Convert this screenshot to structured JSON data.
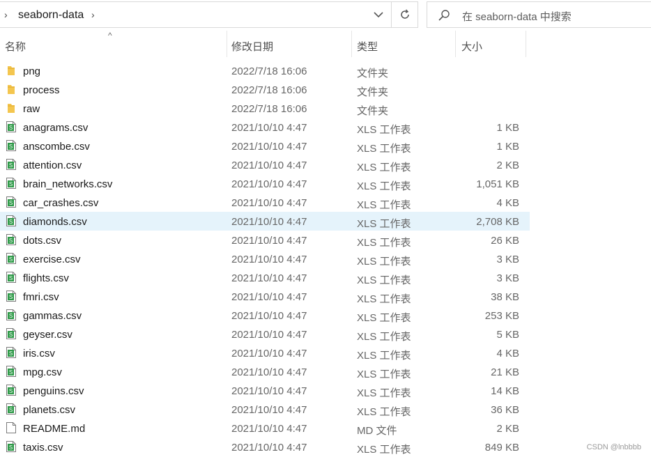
{
  "address": {
    "path": "seaborn-data"
  },
  "search": {
    "placeholder": "在 seaborn-data 中搜索"
  },
  "columns": {
    "name": "名称",
    "date": "修改日期",
    "type": "类型",
    "size": "大小"
  },
  "files": [
    {
      "name": "png",
      "date": "2022/7/18 16:06",
      "type": "文件夹",
      "size": "",
      "icon": "folder-icon"
    },
    {
      "name": "process",
      "date": "2022/7/18 16:06",
      "type": "文件夹",
      "size": "",
      "icon": "folder-icon"
    },
    {
      "name": "raw",
      "date": "2022/7/18 16:06",
      "type": "文件夹",
      "size": "",
      "icon": "folder-icon"
    },
    {
      "name": "anagrams.csv",
      "date": "2021/10/10 4:47",
      "type": "XLS 工作表",
      "size": "1 KB",
      "icon": "spreadsheet-icon"
    },
    {
      "name": "anscombe.csv",
      "date": "2021/10/10 4:47",
      "type": "XLS 工作表",
      "size": "1 KB",
      "icon": "spreadsheet-icon"
    },
    {
      "name": "attention.csv",
      "date": "2021/10/10 4:47",
      "type": "XLS 工作表",
      "size": "2 KB",
      "icon": "spreadsheet-icon"
    },
    {
      "name": "brain_networks.csv",
      "date": "2021/10/10 4:47",
      "type": "XLS 工作表",
      "size": "1,051 KB",
      "icon": "spreadsheet-icon"
    },
    {
      "name": "car_crashes.csv",
      "date": "2021/10/10 4:47",
      "type": "XLS 工作表",
      "size": "4 KB",
      "icon": "spreadsheet-icon"
    },
    {
      "name": "diamonds.csv",
      "date": "2021/10/10 4:47",
      "type": "XLS 工作表",
      "size": "2,708 KB",
      "icon": "spreadsheet-icon",
      "selected": true
    },
    {
      "name": "dots.csv",
      "date": "2021/10/10 4:47",
      "type": "XLS 工作表",
      "size": "26 KB",
      "icon": "spreadsheet-icon"
    },
    {
      "name": "exercise.csv",
      "date": "2021/10/10 4:47",
      "type": "XLS 工作表",
      "size": "3 KB",
      "icon": "spreadsheet-icon"
    },
    {
      "name": "flights.csv",
      "date": "2021/10/10 4:47",
      "type": "XLS 工作表",
      "size": "3 KB",
      "icon": "spreadsheet-icon"
    },
    {
      "name": "fmri.csv",
      "date": "2021/10/10 4:47",
      "type": "XLS 工作表",
      "size": "38 KB",
      "icon": "spreadsheet-icon"
    },
    {
      "name": "gammas.csv",
      "date": "2021/10/10 4:47",
      "type": "XLS 工作表",
      "size": "253 KB",
      "icon": "spreadsheet-icon"
    },
    {
      "name": "geyser.csv",
      "date": "2021/10/10 4:47",
      "type": "XLS 工作表",
      "size": "5 KB",
      "icon": "spreadsheet-icon"
    },
    {
      "name": "iris.csv",
      "date": "2021/10/10 4:47",
      "type": "XLS 工作表",
      "size": "4 KB",
      "icon": "spreadsheet-icon"
    },
    {
      "name": "mpg.csv",
      "date": "2021/10/10 4:47",
      "type": "XLS 工作表",
      "size": "21 KB",
      "icon": "spreadsheet-icon"
    },
    {
      "name": "penguins.csv",
      "date": "2021/10/10 4:47",
      "type": "XLS 工作表",
      "size": "14 KB",
      "icon": "spreadsheet-icon"
    },
    {
      "name": "planets.csv",
      "date": "2021/10/10 4:47",
      "type": "XLS 工作表",
      "size": "36 KB",
      "icon": "spreadsheet-icon"
    },
    {
      "name": "README.md",
      "date": "2021/10/10 4:47",
      "type": "MD 文件",
      "size": "2 KB",
      "icon": "document-icon"
    },
    {
      "name": "taxis.csv",
      "date": "2021/10/10 4:47",
      "type": "XLS 工作表",
      "size": "849 KB",
      "icon": "spreadsheet-icon"
    }
  ],
  "watermark": "CSDN @lnbbbb",
  "colors": {
    "selection": "#e5f3fb",
    "folder": "#f4c64f",
    "sheet": "#2e9a48"
  }
}
